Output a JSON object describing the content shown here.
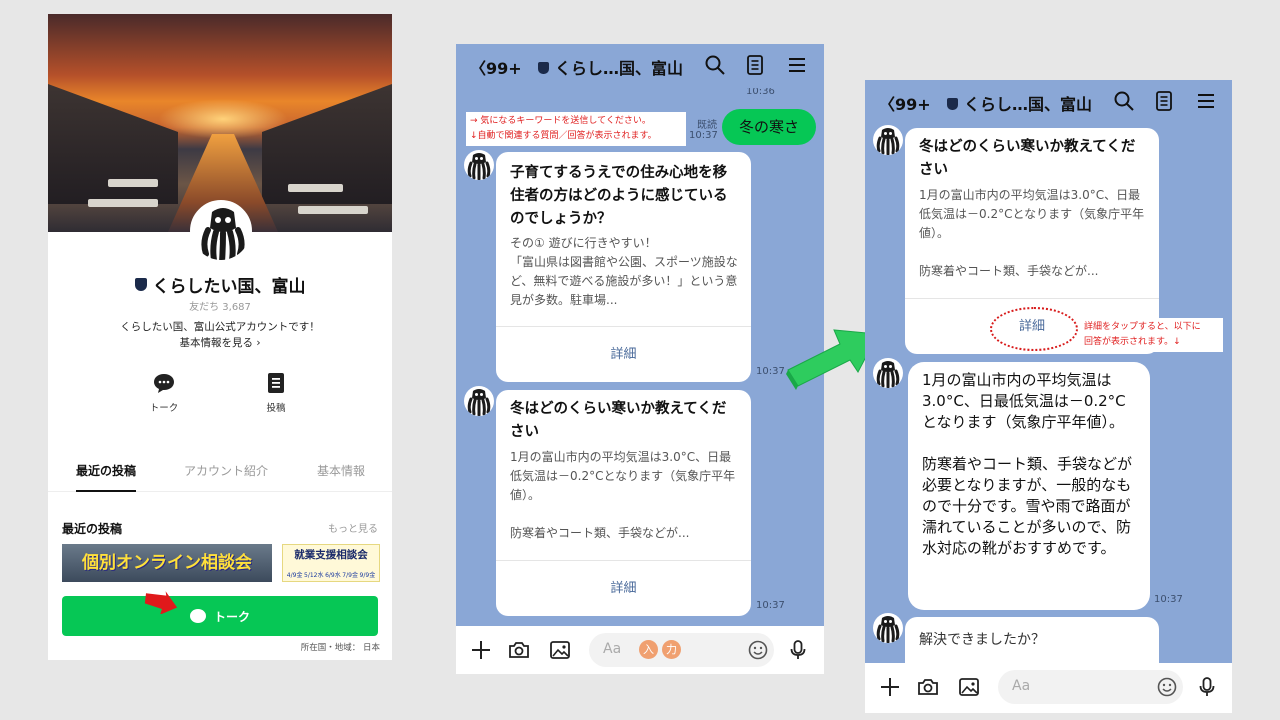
{
  "profile": {
    "name": "くらしたい国、富山",
    "friends": "友だち 3,687",
    "description": "くらしたい国、富山公式アカウントです！",
    "basic_info_link": "基本情報を見る",
    "actions": [
      {
        "label": "トーク",
        "icon": "chat-icon"
      },
      {
        "label": "投稿",
        "icon": "post-icon"
      }
    ],
    "tabs": [
      "最近の投稿",
      "アカウント紹介",
      "基本情報"
    ],
    "recent_title": "最近の投稿",
    "more": "もっと見る",
    "banner1": "個別オンライン相談会",
    "banner2_title": "就業支援相談会",
    "banner2_dates": [
      "4/9金",
      "5/12水",
      "6/9水",
      "7/9金",
      "9/9金"
    ],
    "talk_button": "トーク",
    "country": "所在国・地域： 日本"
  },
  "chat": {
    "back_count": "99+",
    "title": "くらし…国、富山",
    "top_time": "10:36",
    "note_lines": [
      "→ 気になるキーワードを送信してください。",
      "↓自動で関連する質問／回答が表示されます。"
    ],
    "read_label": "既読",
    "read_time": "10:37",
    "user_message": "冬の寒さ",
    "card1": {
      "question": "子育てするうえでの住み心地を移住者の方はどのように感じているのでしょうか？",
      "answer": "その① 遊びに行きやすい！\n「富山県は図書館や公園、スポーツ施設など、無料で遊べる施設が多い！」という意見が多数。駐車場...",
      "detail": "詳細",
      "time": "10:37"
    },
    "card2": {
      "question": "冬はどのくらい寒いか教えてください",
      "answer": "1月の富山市内の平均気温は3.0°C、日最低気温は－0.2°Cとなります（気象庁平年値）。\n\n防寒着やコート類、手袋などが...",
      "detail": "詳細",
      "time": "10:37"
    },
    "input_placeholder": "Aa",
    "input_badges": [
      "入",
      "力"
    ]
  },
  "chat2": {
    "back_count": "99+",
    "title": "くらし…国、富山",
    "card": {
      "question": "冬はどのくらい寒いか教えてください",
      "answer": "1月の富山市内の平均気温は3.0°C、日最低気温は－0.2°Cとなります（気象庁平年値）。\n\n防寒着やコート類、手袋などが...",
      "detail": "詳細"
    },
    "note_lines": [
      "詳細をタップすると、以下に",
      "回答が表示されます。↓"
    ],
    "answer_bubble": "1月の富山市内の平均気温は3.0°C、日最低気温は－0.2°Cとなります（気象庁平年値）。\n\n防寒着やコート類、手袋などが必要となりますが、一般的なもので十分です。雪や雨で路面が濡れていることが多いので、防水対応の靴がおすすめです。",
    "answer_time": "10:37",
    "followup": "解決できましたか？",
    "input_placeholder": "Aa"
  },
  "colors": {
    "line_green": "#06c755",
    "chat_bg": "#8aa7d6",
    "arrow_green": "#2ecc5e",
    "annotation_red": "#e02020"
  }
}
